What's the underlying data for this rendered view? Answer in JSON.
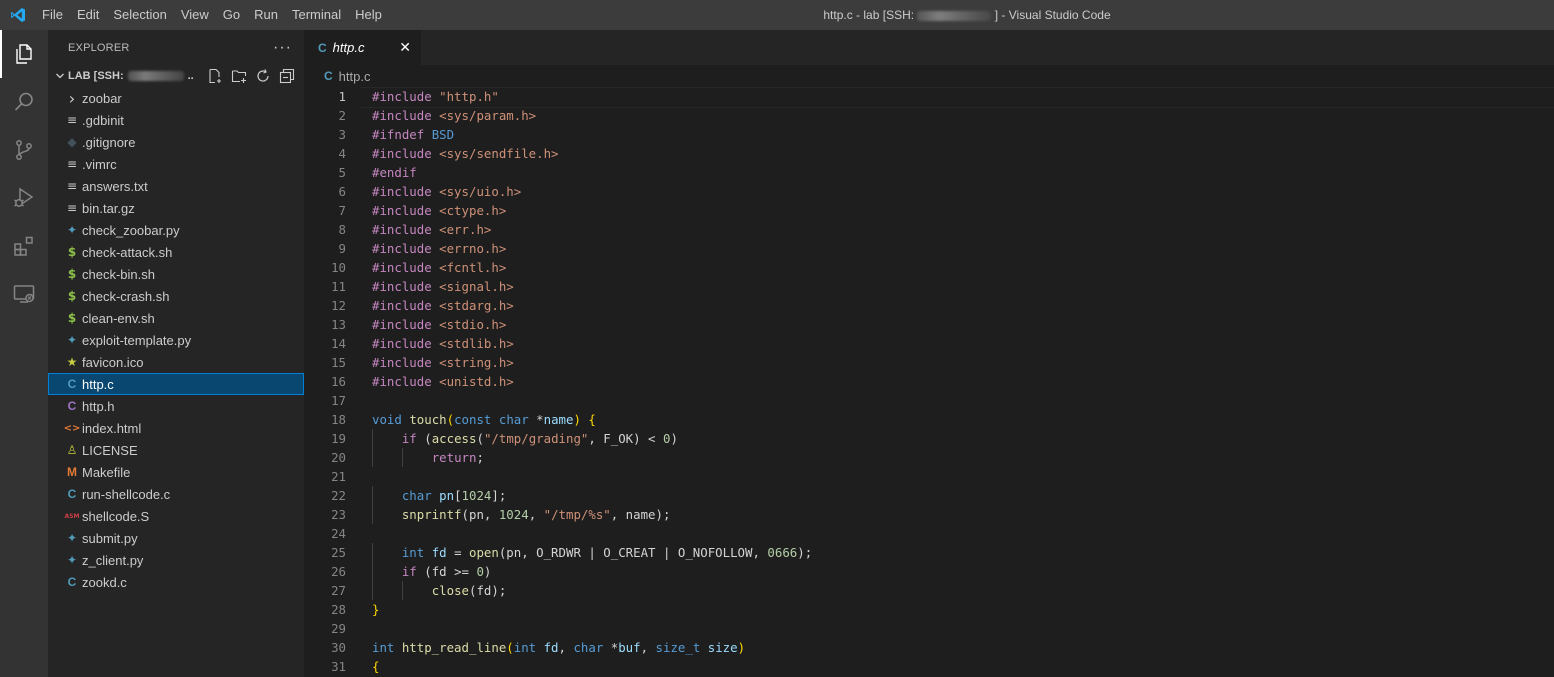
{
  "titlebar": {
    "menu": [
      "File",
      "Edit",
      "Selection",
      "View",
      "Go",
      "Run",
      "Terminal",
      "Help"
    ],
    "title_prefix": "http.c - lab [SSH:",
    "title_suffix": "] - Visual Studio Code"
  },
  "activity_bar": [
    "explorer-icon",
    "search-icon",
    "source-control-icon",
    "run-debug-icon",
    "extensions-icon",
    "remote-explorer-icon"
  ],
  "sidebar": {
    "header": "EXPLORER",
    "menu_label": "···",
    "folder_label": "LAB [SSH:",
    "folder_label_suffix": "..",
    "files": [
      {
        "name": "zoobar",
        "icon": "chevron-right-icon",
        "glyph": "›",
        "color": "#cccccc",
        "folder": true
      },
      {
        "name": ".gdbinit",
        "icon": "file-lines-icon",
        "glyph": "≡",
        "color": "#cccccc"
      },
      {
        "name": ".gitignore",
        "icon": "git-diamond-icon",
        "glyph": "◆",
        "color": "#41535b"
      },
      {
        "name": ".vimrc",
        "icon": "file-lines-icon",
        "glyph": "≡",
        "color": "#cccccc"
      },
      {
        "name": "answers.txt",
        "icon": "file-lines-icon",
        "glyph": "≡",
        "color": "#cccccc"
      },
      {
        "name": "bin.tar.gz",
        "icon": "file-lines-icon",
        "glyph": "≡",
        "color": "#cccccc"
      },
      {
        "name": "check_zoobar.py",
        "icon": "python-icon",
        "glyph": "✦",
        "color": "#519aba"
      },
      {
        "name": "check-attack.sh",
        "icon": "shell-dollar-icon",
        "glyph": "$",
        "color": "#8dc149"
      },
      {
        "name": "check-bin.sh",
        "icon": "shell-dollar-icon",
        "glyph": "$",
        "color": "#8dc149"
      },
      {
        "name": "check-crash.sh",
        "icon": "shell-dollar-icon",
        "glyph": "$",
        "color": "#8dc149"
      },
      {
        "name": "clean-env.sh",
        "icon": "shell-dollar-icon",
        "glyph": "$",
        "color": "#8dc149"
      },
      {
        "name": "exploit-template.py",
        "icon": "python-icon",
        "glyph": "✦",
        "color": "#519aba"
      },
      {
        "name": "favicon.ico",
        "icon": "star-icon",
        "glyph": "★",
        "color": "#cbcb41"
      },
      {
        "name": "http.c",
        "icon": "c-file-icon",
        "glyph": "C",
        "color": "#519aba",
        "selected": true
      },
      {
        "name": "http.h",
        "icon": "h-file-icon",
        "glyph": "C",
        "color": "#a074c4"
      },
      {
        "name": "index.html",
        "icon": "html-icon",
        "glyph": "<>",
        "color": "#e37933"
      },
      {
        "name": "LICENSE",
        "icon": "license-icon",
        "glyph": "♙",
        "color": "#cbcb41"
      },
      {
        "name": "Makefile",
        "icon": "makefile-icon",
        "glyph": "M",
        "color": "#e37933"
      },
      {
        "name": "run-shellcode.c",
        "icon": "c-file-icon",
        "glyph": "C",
        "color": "#519aba"
      },
      {
        "name": "shellcode.S",
        "icon": "asm-icon",
        "glyph": "ASM",
        "color": "#cc3e44"
      },
      {
        "name": "submit.py",
        "icon": "python-icon",
        "glyph": "✦",
        "color": "#519aba"
      },
      {
        "name": "z_client.py",
        "icon": "python-icon",
        "glyph": "✦",
        "color": "#519aba"
      },
      {
        "name": "zookd.c",
        "icon": "c-file-icon",
        "glyph": "C",
        "color": "#519aba"
      }
    ]
  },
  "editor": {
    "tab": {
      "label": "http.c",
      "icon_glyph": "C",
      "close": "✕"
    },
    "breadcrumb": {
      "icon_glyph": "C",
      "label": "http.c"
    },
    "colors": {
      "keyword": "#569cd6",
      "directive": "#c586c0",
      "string": "#ce9178",
      "function": "#dcdcaa",
      "variable": "#9cdcfe",
      "number": "#b5cea8",
      "text": "#d4d4d4",
      "brace": "#ffd700"
    },
    "lines": [
      [
        [
          "#include ",
          "directive"
        ],
        [
          "\"http.h\"",
          "string"
        ]
      ],
      [
        [
          "#include ",
          "directive"
        ],
        [
          "<sys/param.h>",
          "string"
        ]
      ],
      [
        [
          "#ifndef ",
          "directive"
        ],
        [
          "BSD",
          "keyword"
        ]
      ],
      [
        [
          "#include ",
          "directive"
        ],
        [
          "<sys/sendfile.h>",
          "string"
        ]
      ],
      [
        [
          "#endif",
          "directive"
        ]
      ],
      [
        [
          "#include ",
          "directive"
        ],
        [
          "<sys/uio.h>",
          "string"
        ]
      ],
      [
        [
          "#include ",
          "directive"
        ],
        [
          "<ctype.h>",
          "string"
        ]
      ],
      [
        [
          "#include ",
          "directive"
        ],
        [
          "<err.h>",
          "string"
        ]
      ],
      [
        [
          "#include ",
          "directive"
        ],
        [
          "<errno.h>",
          "string"
        ]
      ],
      [
        [
          "#include ",
          "directive"
        ],
        [
          "<fcntl.h>",
          "string"
        ]
      ],
      [
        [
          "#include ",
          "directive"
        ],
        [
          "<signal.h>",
          "string"
        ]
      ],
      [
        [
          "#include ",
          "directive"
        ],
        [
          "<stdarg.h>",
          "string"
        ]
      ],
      [
        [
          "#include ",
          "directive"
        ],
        [
          "<stdio.h>",
          "string"
        ]
      ],
      [
        [
          "#include ",
          "directive"
        ],
        [
          "<stdlib.h>",
          "string"
        ]
      ],
      [
        [
          "#include ",
          "directive"
        ],
        [
          "<string.h>",
          "string"
        ]
      ],
      [
        [
          "#include ",
          "directive"
        ],
        [
          "<unistd.h>",
          "string"
        ]
      ],
      [],
      [
        [
          "void ",
          "keyword"
        ],
        [
          "touch",
          "function"
        ],
        [
          "(",
          "brace"
        ],
        [
          "const ",
          "keyword"
        ],
        [
          "char ",
          "keyword"
        ],
        [
          "*",
          "text"
        ],
        [
          "name",
          "variable"
        ],
        [
          ") {",
          "brace"
        ]
      ],
      [
        [
          "    ",
          "text"
        ],
        [
          "if ",
          "directive"
        ],
        [
          "(",
          "text"
        ],
        [
          "access",
          "function"
        ],
        [
          "(",
          "text"
        ],
        [
          "\"/tmp/grading\"",
          "string"
        ],
        [
          ", F_OK) < ",
          "text"
        ],
        [
          "0",
          "number"
        ],
        [
          ")",
          "text"
        ]
      ],
      [
        [
          "        ",
          "text"
        ],
        [
          "return",
          "directive"
        ],
        [
          ";",
          "text"
        ]
      ],
      [],
      [
        [
          "    ",
          "text"
        ],
        [
          "char ",
          "keyword"
        ],
        [
          "pn",
          "variable"
        ],
        [
          "[",
          "text"
        ],
        [
          "1024",
          "number"
        ],
        [
          "];",
          "text"
        ]
      ],
      [
        [
          "    ",
          "text"
        ],
        [
          "snprintf",
          "function"
        ],
        [
          "(pn, ",
          "text"
        ],
        [
          "1024",
          "number"
        ],
        [
          ", ",
          "text"
        ],
        [
          "\"/tmp/%s\"",
          "string"
        ],
        [
          ", name);",
          "text"
        ]
      ],
      [],
      [
        [
          "    ",
          "text"
        ],
        [
          "int ",
          "keyword"
        ],
        [
          "fd",
          "variable"
        ],
        [
          " = ",
          "text"
        ],
        [
          "open",
          "function"
        ],
        [
          "(pn, O_RDWR | O_CREAT | O_NOFOLLOW, ",
          "text"
        ],
        [
          "0666",
          "number"
        ],
        [
          ");",
          "text"
        ]
      ],
      [
        [
          "    ",
          "text"
        ],
        [
          "if ",
          "directive"
        ],
        [
          "(fd >= ",
          "text"
        ],
        [
          "0",
          "number"
        ],
        [
          ")",
          "text"
        ]
      ],
      [
        [
          "        ",
          "text"
        ],
        [
          "close",
          "function"
        ],
        [
          "(fd);",
          "text"
        ]
      ],
      [
        [
          "}",
          "brace"
        ]
      ],
      [],
      [
        [
          "int ",
          "keyword"
        ],
        [
          "http_read_line",
          "function"
        ],
        [
          "(",
          "brace"
        ],
        [
          "int ",
          "keyword"
        ],
        [
          "fd",
          "variable"
        ],
        [
          ", ",
          "text"
        ],
        [
          "char ",
          "keyword"
        ],
        [
          "*",
          "text"
        ],
        [
          "buf",
          "variable"
        ],
        [
          ", ",
          "text"
        ],
        [
          "size_t ",
          "keyword"
        ],
        [
          "size",
          "variable"
        ],
        [
          ")",
          "brace"
        ]
      ],
      [
        [
          "{",
          "brace"
        ]
      ]
    ]
  }
}
